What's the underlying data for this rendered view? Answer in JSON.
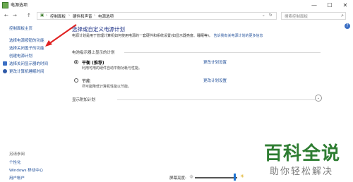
{
  "window": {
    "title": "电源选项",
    "min": "—",
    "max": "☐",
    "close": "✕"
  },
  "nav": {
    "back": "←",
    "forward": "→",
    "up": "↑",
    "breadcrumb": [
      "控制面板",
      "硬件和声音",
      "电源选项"
    ],
    "search_placeholder": "搜索控制面板"
  },
  "sidebar": {
    "home": "控制面板主页",
    "items": [
      {
        "label": "选择电源按钮的功能"
      },
      {
        "label": "选择关闭盖子的功能"
      },
      {
        "label": "创建电源计划"
      },
      {
        "label": "选择关闭显示器的时间"
      },
      {
        "label": "更改计算机睡眠时间"
      }
    ],
    "see_also_title": "另请参阅",
    "see_also": [
      "个性化",
      "Windows 移动中心",
      "用户帐户"
    ]
  },
  "main": {
    "heading": "选择或自定义电源计划",
    "description": "电源计划是用于管理计算机如何使用电源的一套硬件和系统设置(如显示器亮度、睡眠等)。",
    "description_link": "告诉我有关电源计划的更多信息",
    "group_header": "电池指示器上显示的计划",
    "plans": [
      {
        "name": "平衡 (推荐)",
        "desc": "利用可用的硬件自动平衡功耗与性能。",
        "link": "更改计划设置",
        "selected": true
      },
      {
        "name": "节能",
        "desc": "尽可能降低计算机性能以节能。",
        "link": "更改计划设置",
        "selected": false
      }
    ],
    "show_more": "显示附加计划"
  },
  "footer": {
    "brightness_label": "屏幕亮度:"
  },
  "watermark": {
    "big": "百科全说",
    "small": "助你轻松解决"
  }
}
